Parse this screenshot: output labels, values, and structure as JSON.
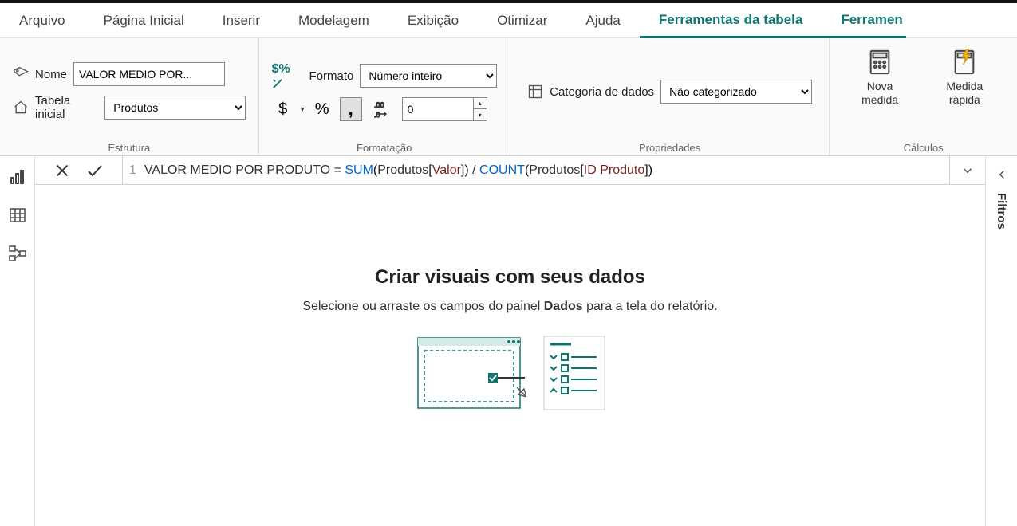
{
  "tabs": {
    "arquivo": "Arquivo",
    "pagina_inicial": "Página Inicial",
    "inserir": "Inserir",
    "modelagem": "Modelagem",
    "exibicao": "Exibição",
    "otimizar": "Otimizar",
    "ajuda": "Ajuda",
    "ferramentas_tabela": "Ferramentas da tabela",
    "ferramentas_trunc": "Ferramen"
  },
  "structure": {
    "name_label": "Nome",
    "name_value": "VALOR MEDIO POR...",
    "home_table_label": "Tabela inicial",
    "home_table_value": "Produtos",
    "group_label": "Estrutura"
  },
  "formatting": {
    "format_label": "Formato",
    "format_value": "Número inteiro",
    "decimal_places": "0",
    "group_label": "Formatação"
  },
  "properties": {
    "category_label": "Categoria de dados",
    "category_value": "Não categorizado",
    "group_label": "Propriedades"
  },
  "calculations": {
    "new_measure": "Nova medida",
    "quick_measure": "Medida rápida",
    "group_label": "Cálculos"
  },
  "formula": {
    "line": "1",
    "measure_name": "VALOR MEDIO POR PRODUTO",
    "equals": " = ",
    "fn_sum": "SUM",
    "tbl1": "Produtos",
    "col1": "Valor",
    "div": " / ",
    "fn_count": "COUNT",
    "tbl2": "Produtos",
    "col2": "ID Produto"
  },
  "canvas": {
    "title": "Criar visuais com seus dados",
    "subtitle_a": "Selecione ou arraste os campos do painel ",
    "subtitle_b": "Dados",
    "subtitle_c": " para a tela do relatório."
  },
  "filters_panel": "Filtros"
}
